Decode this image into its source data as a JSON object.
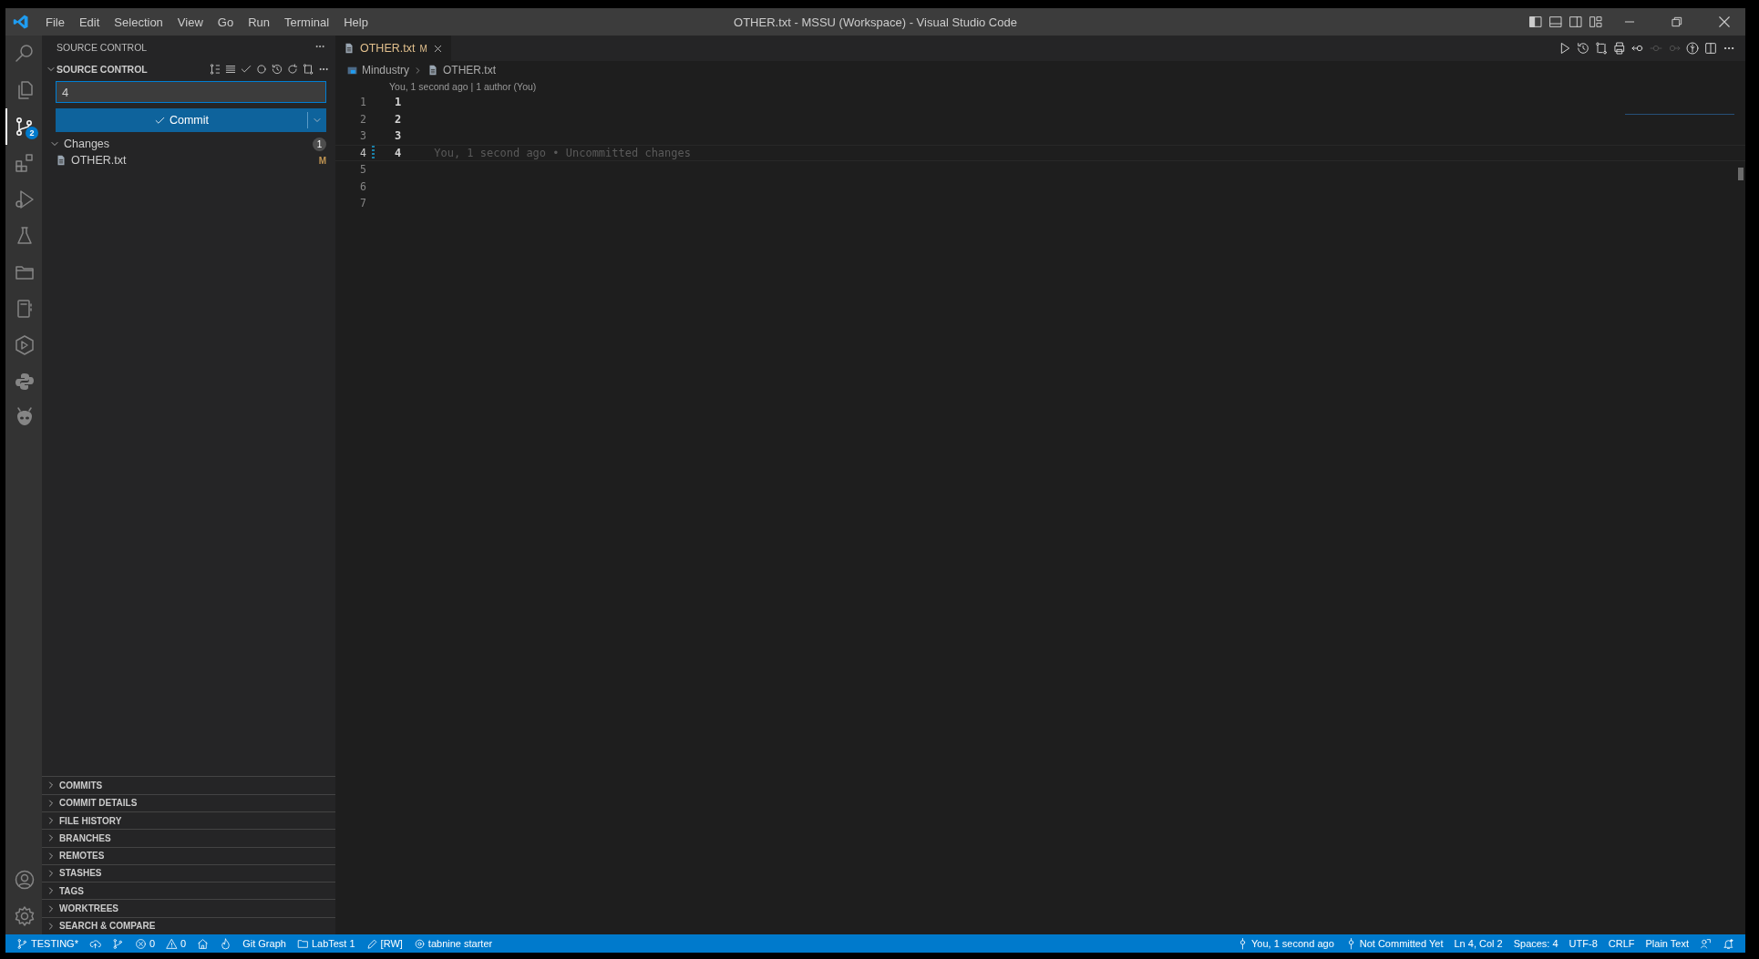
{
  "window": {
    "title": "OTHER.txt - MSSU (Workspace) - Visual Studio Code"
  },
  "menu": [
    "File",
    "Edit",
    "Selection",
    "View",
    "Go",
    "Run",
    "Terminal",
    "Help"
  ],
  "activity_bar": [
    {
      "kind": "search",
      "selected": false
    },
    {
      "kind": "files",
      "selected": false
    },
    {
      "kind": "scm",
      "selected": true,
      "badge": "2"
    },
    {
      "kind": "extensions",
      "selected": false
    },
    {
      "kind": "debug",
      "selected": false
    },
    {
      "kind": "flask",
      "selected": false
    },
    {
      "kind": "folder",
      "selected": false
    },
    {
      "kind": "notebook",
      "selected": false
    },
    {
      "kind": "cube",
      "selected": false
    },
    {
      "kind": "python",
      "selected": false
    },
    {
      "kind": "alien",
      "selected": false
    }
  ],
  "activity_bar_bottom": [
    {
      "kind": "account"
    },
    {
      "kind": "gear"
    }
  ],
  "sidebar": {
    "title": "SOURCE CONTROL",
    "section_title": "SOURCE CONTROL",
    "commit_message": "4",
    "commit_button": "Commit",
    "changes": {
      "label": "Changes",
      "count": "1",
      "expanded": true,
      "files": [
        {
          "name": "OTHER.txt",
          "status": "M"
        }
      ]
    },
    "sections": [
      {
        "label": "COMMITS",
        "expanded": false
      },
      {
        "label": "COMMIT DETAILS",
        "expanded": false
      },
      {
        "label": "FILE HISTORY",
        "expanded": false
      },
      {
        "label": "BRANCHES",
        "expanded": false
      },
      {
        "label": "REMOTES",
        "expanded": false
      },
      {
        "label": "STASHES",
        "expanded": false
      },
      {
        "label": "TAGS",
        "expanded": false
      },
      {
        "label": "WORKTREES",
        "expanded": false
      },
      {
        "label": "SEARCH & COMPARE",
        "expanded": false
      }
    ]
  },
  "tabs": [
    {
      "label": "OTHER.txt",
      "status": "M",
      "selected": true
    }
  ],
  "editor_actions": [
    {
      "kind": "run",
      "disabled": false
    },
    {
      "kind": "history",
      "disabled": false
    },
    {
      "kind": "compare",
      "disabled": false
    },
    {
      "kind": "print",
      "disabled": false
    },
    {
      "kind": "back",
      "disabled": false
    },
    {
      "kind": "dot",
      "disabled": true
    },
    {
      "kind": "forward",
      "disabled": true
    },
    {
      "kind": "blame",
      "disabled": false
    },
    {
      "kind": "split",
      "disabled": false
    },
    {
      "kind": "more",
      "disabled": false
    }
  ],
  "breadcrumbs": [
    "Mindustry",
    "OTHER.txt"
  ],
  "codelens": "You, 1 second ago | 1 author (You)",
  "lines": [
    {
      "number": "1",
      "text": "1",
      "current": false
    },
    {
      "number": "2",
      "text": "2",
      "current": false
    },
    {
      "number": "3",
      "text": "3",
      "current": false
    },
    {
      "number": "4",
      "text": "4",
      "current": true,
      "annotation": "You, 1 second ago • Uncommitted changes"
    },
    {
      "number": "5",
      "current": false
    },
    {
      "number": "6",
      "current": false
    },
    {
      "number": "7",
      "current": false
    }
  ],
  "status_bar": {
    "left": [
      {
        "kind": "branch",
        "text": "TESTING*"
      },
      {
        "kind": "cloud"
      },
      {
        "kind": "scm"
      },
      {
        "kind": "errors",
        "text": "0"
      },
      {
        "kind": "warnings",
        "text": "0"
      },
      {
        "kind": "home"
      },
      {
        "kind": "flame"
      },
      {
        "kind": "plain",
        "text": "Git Graph"
      },
      {
        "kind": "folder",
        "text": "LabTest 1"
      },
      {
        "kind": "pencil",
        "text": "[RW]"
      },
      {
        "kind": "tabnine",
        "text": "tabnine starter"
      }
    ],
    "right": [
      {
        "kind": "commit",
        "text": "You, 1 second ago"
      },
      {
        "kind": "commit",
        "text": "Not Committed Yet"
      },
      {
        "kind": "plain",
        "text": "Ln 4, Col 2"
      },
      {
        "kind": "plain",
        "text": "Spaces: 4"
      },
      {
        "kind": "plain",
        "text": "UTF-8"
      },
      {
        "kind": "plain",
        "text": "CRLF"
      },
      {
        "kind": "plain",
        "text": "Plain Text"
      },
      {
        "kind": "feedback"
      },
      {
        "kind": "bell"
      }
    ]
  }
}
